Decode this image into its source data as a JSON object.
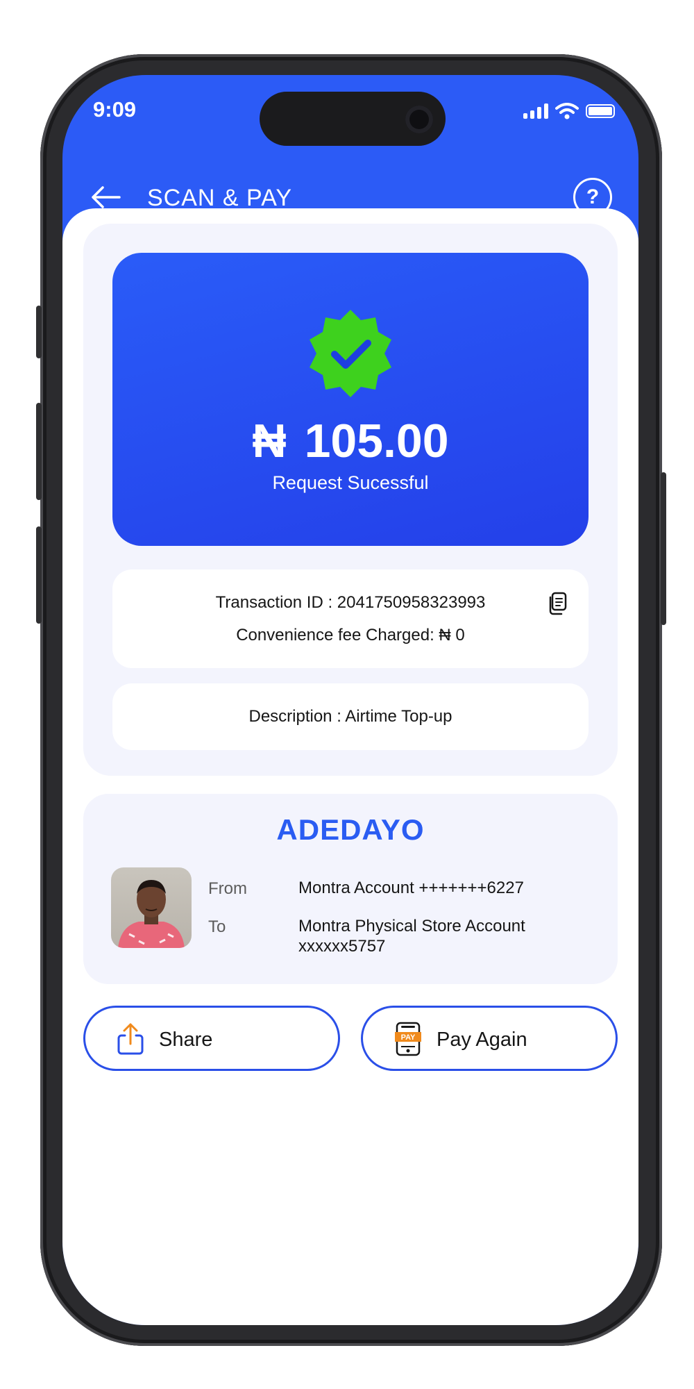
{
  "status_bar": {
    "time": "9:09"
  },
  "header": {
    "title": "SCAN & PAY",
    "help": "?"
  },
  "receipt": {
    "currency": "₦",
    "amount": "105.00",
    "status": "Request Sucessful",
    "transaction_id_line": "Transaction ID : 2041750958323993",
    "fee_line": "Convenience fee Charged: ₦ 0",
    "description_line": "Description : Airtime Top-up"
  },
  "party": {
    "name": "ADEDAYO",
    "from_label": "From",
    "from_value": "Montra Account +++++++6227",
    "to_label": "To",
    "to_value_line1": "Montra Physical Store Account",
    "to_value_line2": "xxxxxx5757"
  },
  "actions": {
    "share_label": "Share",
    "pay_again_label": "Pay Again",
    "pay_icon_text": "PAY"
  },
  "colors": {
    "primary": "#2c5bf6",
    "success": "#3ed11e",
    "accent_orange": "#f08a1c"
  }
}
